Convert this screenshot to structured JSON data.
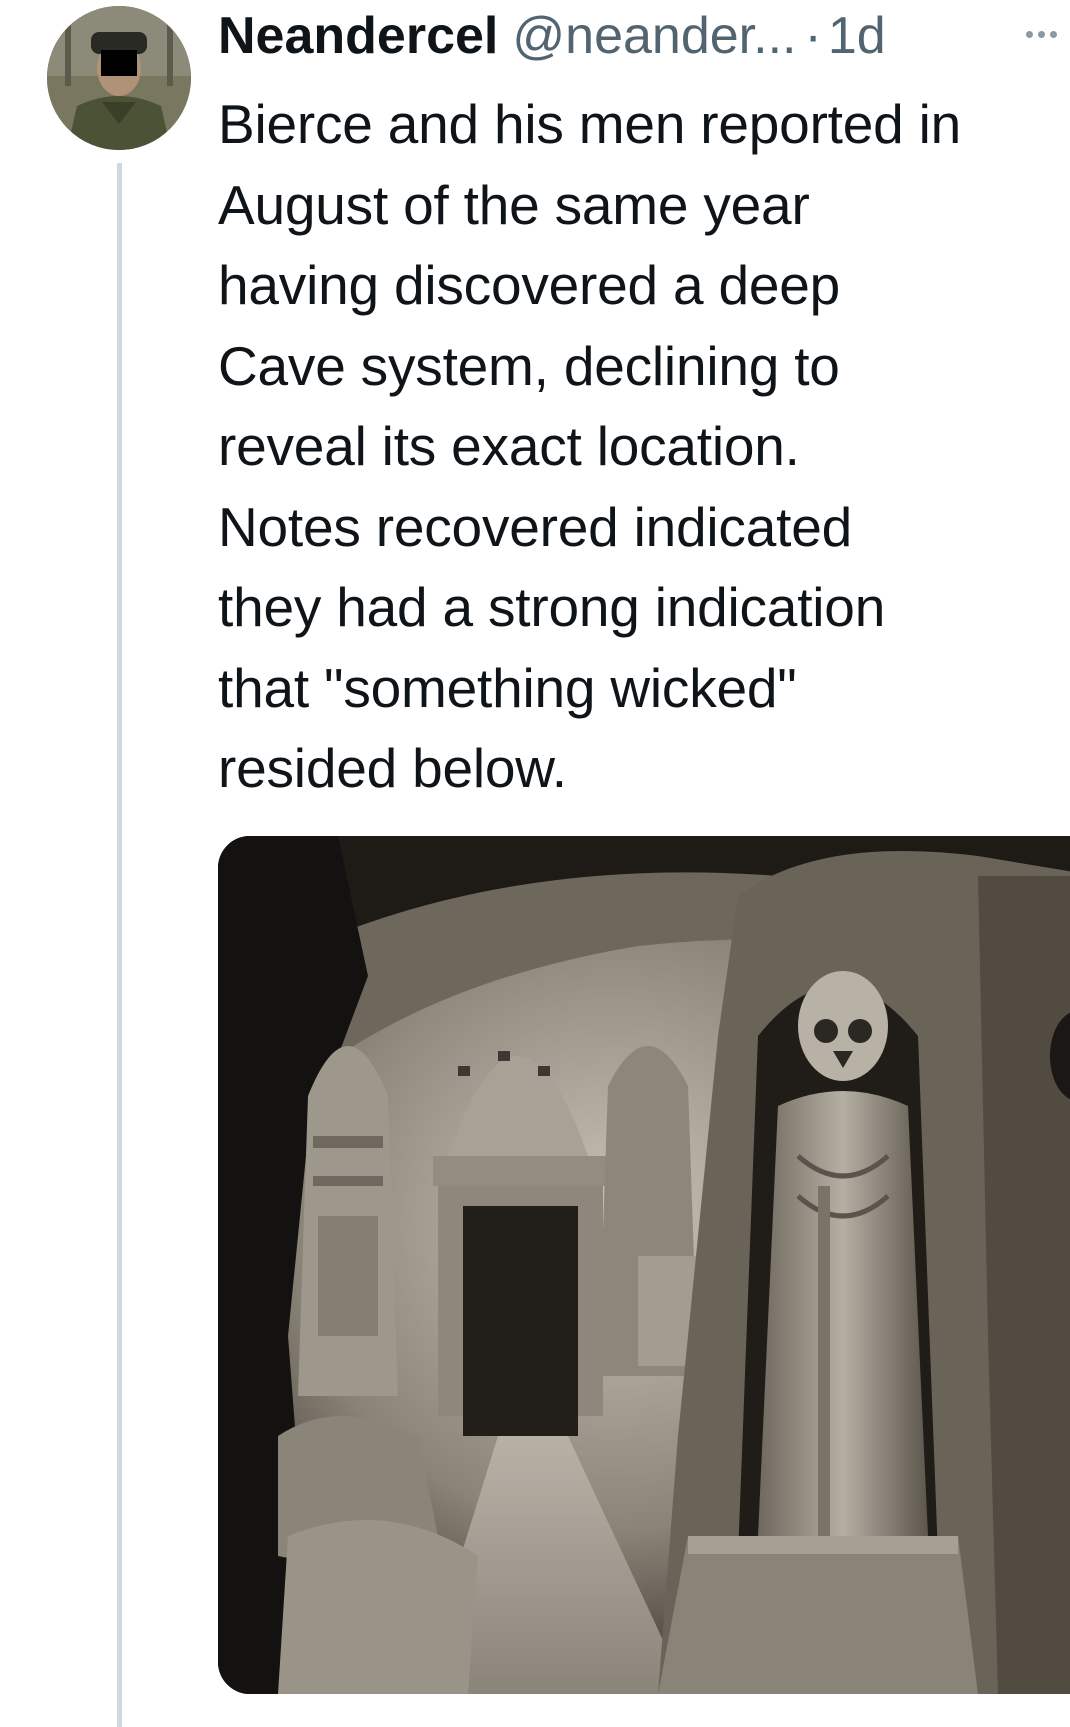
{
  "tweet": {
    "display_name": "Neandercel",
    "handle": "@neander...",
    "separator": "·",
    "time": "1d",
    "text_lines": [
      "Bierce and his men reported in",
      "August of the same year",
      "having discovered a deep",
      "Cave system, declining to",
      "reveal its exact location.",
      "Notes recovered indicated",
      "they had a strong indication",
      "that \"something wicked\"",
      "resided below."
    ]
  },
  "icons": {
    "more": "more-horizontal-icon"
  },
  "colors": {
    "text_primary": "#0f1419",
    "text_secondary": "#536471",
    "thread_line": "#cfd9de",
    "background": "#ffffff"
  }
}
